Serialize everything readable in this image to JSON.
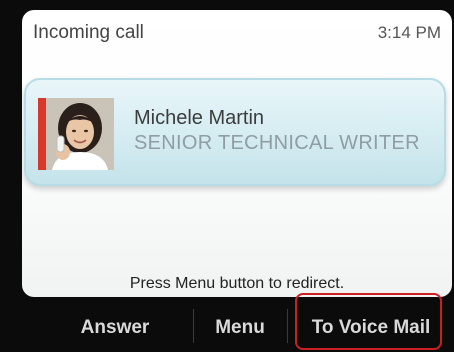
{
  "status_bar": {
    "title": "Incoming call",
    "time": "3:14 PM"
  },
  "caller": {
    "name": "Michele Martin",
    "title": "SENIOR TECHNICAL WRITER",
    "avatar_icon": "person-photo-icon",
    "strip_color": "#d8382a"
  },
  "hint": "Press Menu button to redirect.",
  "softkeys": {
    "answer": "Answer",
    "menu": "Menu",
    "voicemail": "To Voice Mail"
  },
  "highlight_color": "#cc1f24"
}
